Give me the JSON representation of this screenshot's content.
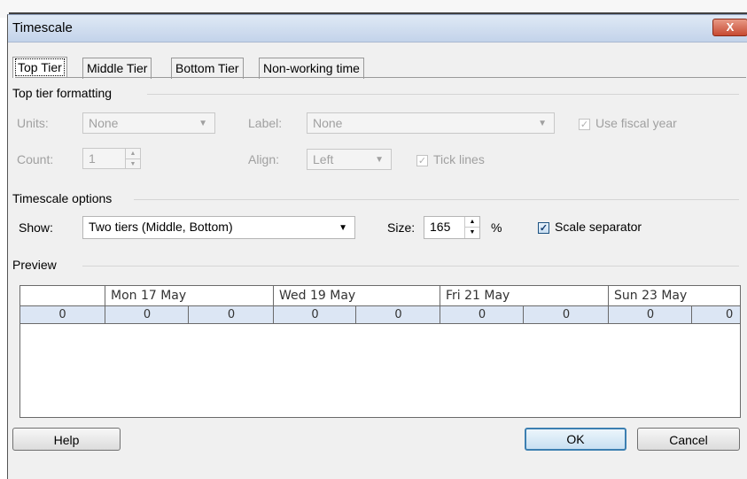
{
  "dialog": {
    "title": "Timescale",
    "close_label": "X"
  },
  "tabs": [
    {
      "label": "Top Tier",
      "active": true
    },
    {
      "label": "Middle Tier",
      "active": false
    },
    {
      "label": "Bottom Tier",
      "active": false
    },
    {
      "label": "Non-working time",
      "active": false
    }
  ],
  "tier_formatting": {
    "heading": "Top tier formatting",
    "units_label": "Units:",
    "units_value": "None",
    "label_label": "Label:",
    "label_value": "None",
    "fiscal_year_label": "Use fiscal year",
    "fiscal_year_checked": true,
    "count_label": "Count:",
    "count_value": "1",
    "align_label": "Align:",
    "align_value": "Left",
    "tick_lines_label": "Tick lines",
    "tick_lines_checked": true
  },
  "timescale_options": {
    "heading": "Timescale options",
    "show_label": "Show:",
    "show_value": "Two tiers (Middle, Bottom)",
    "size_label": "Size:",
    "size_value": "165",
    "size_unit": "%",
    "scale_separator_label": "Scale separator",
    "scale_separator_checked": true
  },
  "preview": {
    "heading": "Preview",
    "tier1": [
      "Mon 17 May",
      "Wed 19 May",
      "Fri 21 May",
      "Sun 23 May"
    ],
    "tier2": [
      "0",
      "0",
      "0",
      "0",
      "0",
      "0",
      "0",
      "0",
      "0"
    ]
  },
  "buttons": {
    "help": "Help",
    "ok": "OK",
    "cancel": "Cancel"
  },
  "colors": {
    "title_bar": "#c3d3ea",
    "close_button": "#c74a32",
    "preview_tier2_bg": "#dce6f4",
    "default_button_border": "#3c7fb1"
  }
}
